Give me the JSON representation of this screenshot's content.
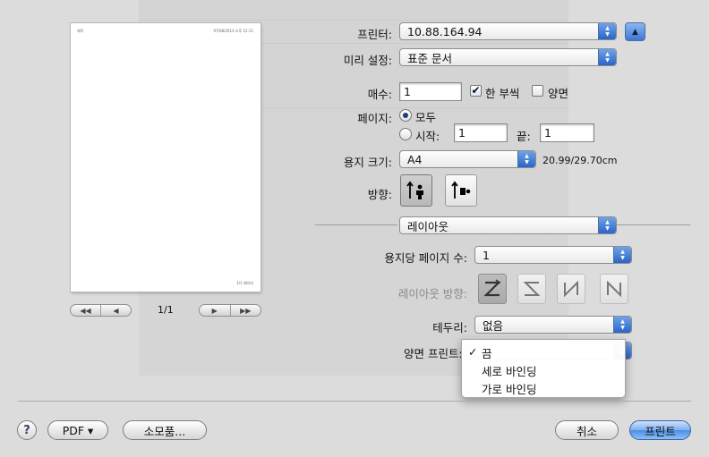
{
  "preview": {
    "header_left": "제목",
    "header_right": "07/08/2013 오후 12:11",
    "footer_right": "1/1 페이지",
    "page_counter": "1/1",
    "first_prev_icons": [
      "◀◀",
      "◀"
    ],
    "next_last_icons": [
      "▶",
      "▶▶"
    ]
  },
  "printer": {
    "label": "프린터:",
    "value": "10.88.164.94",
    "expand_icon": "▲"
  },
  "presets": {
    "label": "미리 설정:",
    "value": "표준 문서"
  },
  "copies": {
    "label": "매수:",
    "value": "1",
    "collated_check": "✔",
    "collated_label": "한 부씩",
    "duplex_label": "양면"
  },
  "pages": {
    "label": "페이지:",
    "all_label": "모두",
    "from_label": "시작:",
    "from_value": "1",
    "to_label": "끝:",
    "to_value": "1"
  },
  "paper_size": {
    "label": "용지 크기:",
    "value": "A4",
    "dimensions": "20.99/29.70cm"
  },
  "orientation": {
    "label": "방향:"
  },
  "section": {
    "value": "레이아웃"
  },
  "pages_per_sheet": {
    "label": "용지당 페이지 수:",
    "value": "1"
  },
  "layout_direction": {
    "label": "레이아웃 방향:",
    "options": [
      "Z",
      "Z-reverse",
      "N-reverse",
      "N"
    ]
  },
  "border": {
    "label": "테두리:",
    "value": "없음"
  },
  "two_sided": {
    "label": "양면 프린트:"
  },
  "menu": {
    "check": "✓",
    "items": [
      "끔",
      "세로 바인딩",
      "가로 바인딩"
    ]
  },
  "buttons": {
    "help": "?",
    "pdf": "PDF ▾",
    "supplies": "소모품...",
    "cancel": "취소",
    "print": "프린트"
  },
  "colors": {
    "accent": "#2b64c8",
    "background": "#dcdcdc"
  }
}
